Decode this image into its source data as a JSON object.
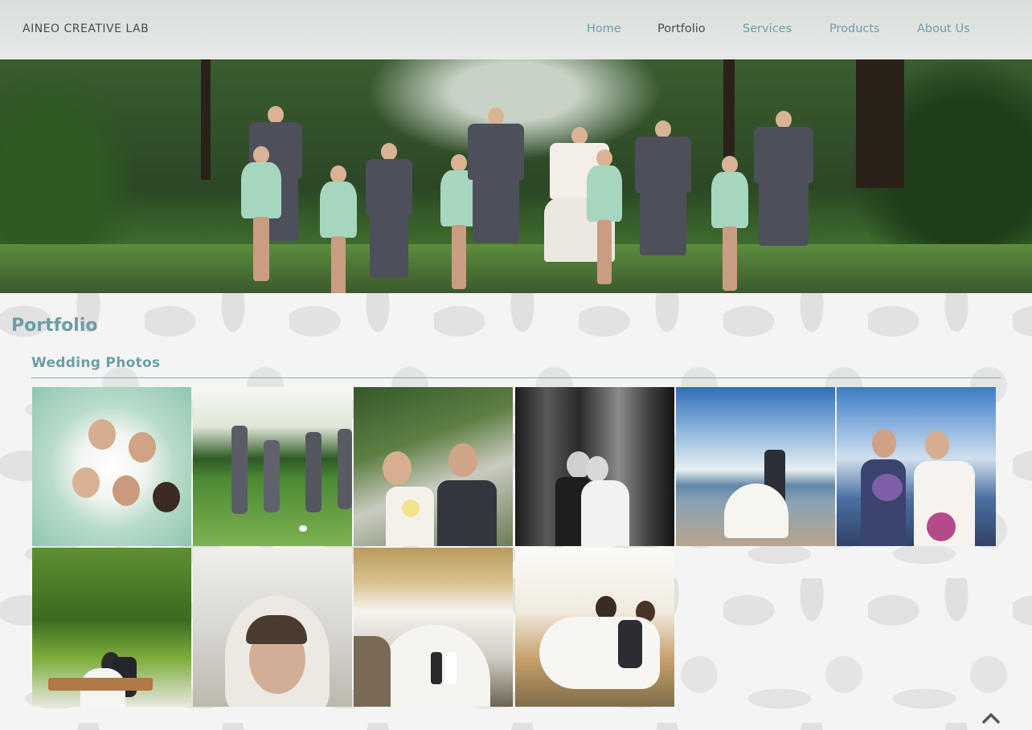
{
  "header": {
    "brand": "AINEO CREATIVE LAB",
    "nav": [
      {
        "label": "Home",
        "active": false
      },
      {
        "label": "Portfolio",
        "active": true
      },
      {
        "label": "Services",
        "active": false
      },
      {
        "label": "Products",
        "active": false
      },
      {
        "label": "About Us",
        "active": false
      }
    ]
  },
  "page": {
    "title": "Portfolio",
    "section_title": "Wedding Photos"
  },
  "gallery": {
    "photo_count": 10
  },
  "icons": {
    "scroll_top": "chevron-up-icon"
  },
  "colors": {
    "accent": "#6c9ea6",
    "nav_active": "#4a4a4a",
    "header_bg": "#e3e7e5"
  }
}
